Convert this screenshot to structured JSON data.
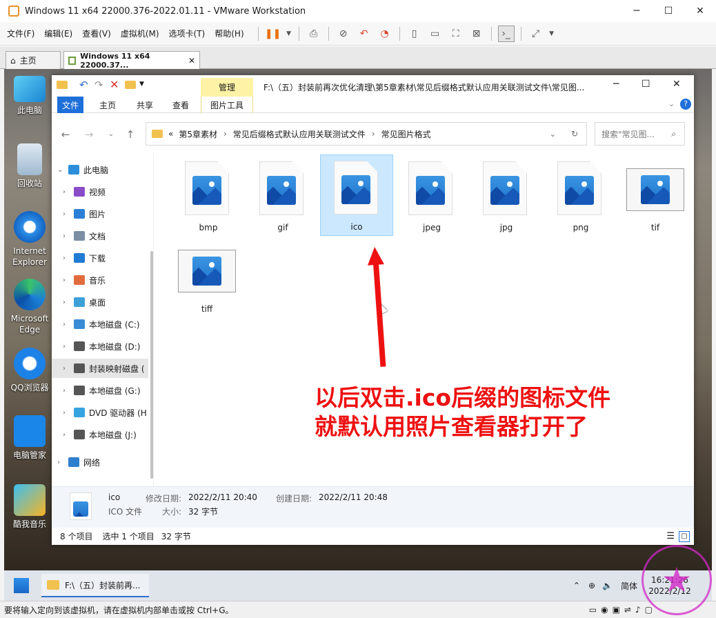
{
  "vm": {
    "title": "Windows 11 x64 22000.376-2022.01.11 - VMware Workstation",
    "menu": [
      "文件(F)",
      "编辑(E)",
      "查看(V)",
      "虚拟机(M)",
      "选项卡(T)",
      "帮助(H)"
    ],
    "tabs": {
      "home": "主页",
      "vm": "Windows 11 x64 22000.37..."
    },
    "status_text": "要将输入定向到该虚拟机，请在虚拟机内部单击或按 Ctrl+G。"
  },
  "desktop": {
    "icons": [
      "此电脑",
      "回收站",
      "Internet Explorer",
      "Microsoft Edge",
      "QQ浏览器",
      "电脑管家",
      "酷我音乐"
    ]
  },
  "explorer": {
    "title_path": "F:\\（五）封装前再次优化清理\\第5章素材\\常见后缀格式默认应用关联测试文件\\常见图...",
    "manage_tab": "管理",
    "ribbon_tabs": [
      "文件",
      "主页",
      "共享",
      "查看"
    ],
    "picture_tools": "图片工具",
    "breadcrumb": {
      "prefix": "«",
      "items": [
        "第5章素材",
        "常见后缀格式默认应用关联测试文件",
        "常见图片格式"
      ]
    },
    "search_placeholder": "搜索\"常见图...",
    "nav": [
      {
        "label": "此电脑",
        "icon": "pc-icon",
        "color": "#2b8fdc"
      },
      {
        "label": "视频",
        "icon": "video-icon",
        "color": "#8a4dc9"
      },
      {
        "label": "图片",
        "icon": "pictures-icon",
        "color": "#2c7fd6"
      },
      {
        "label": "文档",
        "icon": "documents-icon",
        "color": "#7b8ea3"
      },
      {
        "label": "下载",
        "icon": "downloads-icon",
        "color": "#1f7bd3"
      },
      {
        "label": "音乐",
        "icon": "music-icon",
        "color": "#e26b3c"
      },
      {
        "label": "桌面",
        "icon": "desktop-icon",
        "color": "#3ea0d9"
      },
      {
        "label": "本地磁盘 (C:)",
        "icon": "windows-drive-icon",
        "color": "#3a8bd6"
      },
      {
        "label": "本地磁盘 (D:)",
        "icon": "drive-icon",
        "color": "#555555"
      },
      {
        "label": "封装映射磁盘 (",
        "icon": "drive-icon",
        "color": "#555555"
      },
      {
        "label": "本地磁盘 (G:)",
        "icon": "drive-icon",
        "color": "#555555"
      },
      {
        "label": "DVD 驱动器 (H",
        "icon": "dvd-icon",
        "color": "#35a3e0"
      },
      {
        "label": "本地磁盘 (J:)",
        "icon": "drive-icon",
        "color": "#555555"
      },
      {
        "label": "网络",
        "icon": "network-icon",
        "color": "#2f7fcf"
      }
    ],
    "files": [
      "bmp",
      "gif",
      "ico",
      "jpeg",
      "jpg",
      "png",
      "tif",
      "tiff"
    ],
    "details": {
      "name": "ico",
      "type": "ICO 文件",
      "modified_label": "修改日期:",
      "modified": "2022/2/11 20:40",
      "size_label": "大小:",
      "size": "32 字节",
      "created_label": "创建日期:",
      "created": "2022/2/11 20:48"
    },
    "status": {
      "count": "8 个项目",
      "selected": "选中 1 个项目",
      "size": "32 字节"
    }
  },
  "annotation": [
    "以后双击.ico后缀的图标文件",
    "就默认用照片查看器打开了"
  ],
  "taskbar": {
    "task": "F:\\（五）封装前再...",
    "ime": "简体",
    "time": "16:21:26",
    "date": "2022/2/12"
  },
  "colors": {
    "accent": "#1e6fd9",
    "annotation": "#ee1111",
    "selection": "#cce8ff",
    "manage_tab": "#fdf2a6"
  }
}
